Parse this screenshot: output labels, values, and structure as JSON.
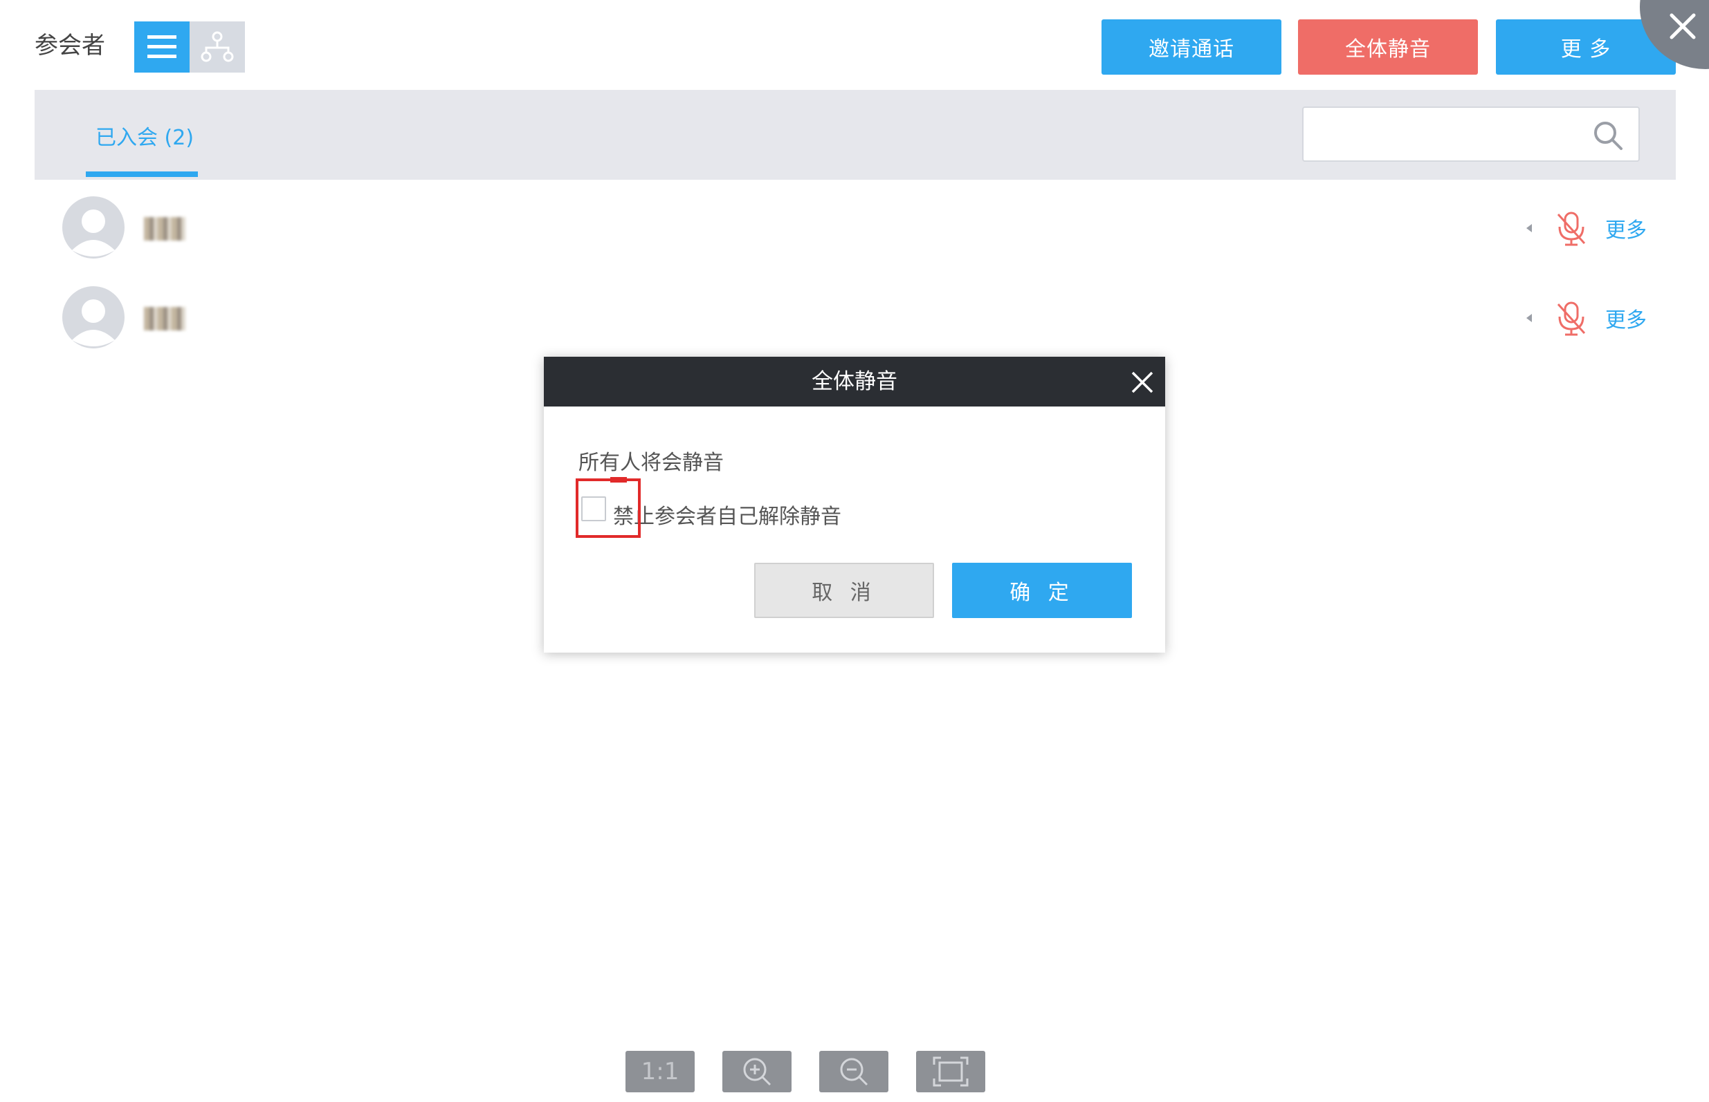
{
  "header": {
    "title": "参会者",
    "invite_label": "邀请通话",
    "mute_all_label": "全体静音",
    "more_label": "更 多"
  },
  "tabs": {
    "joined_label": "已入会 (2)"
  },
  "search": {
    "placeholder": ""
  },
  "participants": [
    {
      "name": "**",
      "more_label": "更多"
    },
    {
      "name": "**",
      "more_label": "更多"
    }
  ],
  "modal": {
    "title": "全体静音",
    "message": "所有人将会静音",
    "checkbox_label": "禁止参会者自己解除静音",
    "cancel_label": "取 消",
    "confirm_label": "确 定"
  },
  "zoom_toolbar": {
    "actual_size_label": "1:1"
  },
  "colors": {
    "primary": "#2fa8f0",
    "danger": "#ef6d67",
    "modal_header": "#2b2e33",
    "highlight": "#e12a2a"
  }
}
